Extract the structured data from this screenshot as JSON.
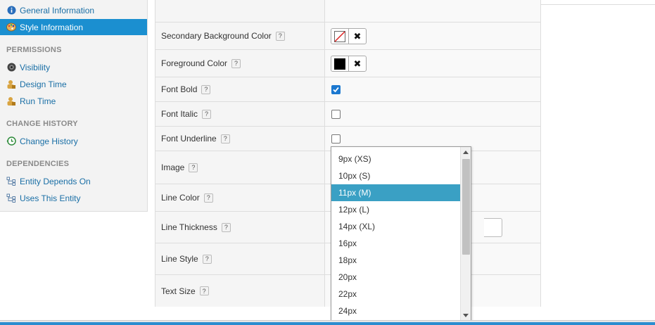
{
  "sidebar": {
    "items_top": [
      {
        "label": "General Information",
        "icon": "info-icon",
        "active": false
      },
      {
        "label": "Style Information",
        "icon": "palette-icon",
        "active": true
      }
    ],
    "sections": [
      {
        "title": "PERMISSIONS",
        "items": [
          {
            "label": "Visibility",
            "icon": "eye-icon"
          },
          {
            "label": "Design Time",
            "icon": "user-lock-icon"
          },
          {
            "label": "Run Time",
            "icon": "user-lock-icon"
          }
        ]
      },
      {
        "title": "CHANGE HISTORY",
        "items": [
          {
            "label": "Change History",
            "icon": "history-icon"
          }
        ]
      },
      {
        "title": "DEPENDENCIES",
        "items": [
          {
            "label": "Entity Depends On",
            "icon": "dependency-icon"
          },
          {
            "label": "Uses This Entity",
            "icon": "dependency-icon"
          }
        ]
      }
    ]
  },
  "properties": {
    "secondary_background_color": {
      "label": "Secondary Background Color",
      "help": "?",
      "clear": "✖"
    },
    "foreground_color": {
      "label": "Foreground Color",
      "help": "?",
      "clear": "✖",
      "value": "#000000"
    },
    "font_bold": {
      "label": "Font Bold",
      "help": "?",
      "checked": true
    },
    "font_italic": {
      "label": "Font Italic",
      "help": "?",
      "checked": false
    },
    "font_underline": {
      "label": "Font Underline",
      "help": "?",
      "checked": false
    },
    "image": {
      "label": "Image",
      "help": "?"
    },
    "line_color": {
      "label": "Line Color",
      "help": "?"
    },
    "line_thickness": {
      "label": "Line Thickness",
      "help": "?"
    },
    "line_style": {
      "label": "Line Style",
      "help": "?"
    },
    "text_size": {
      "label": "Text Size",
      "help": "?"
    }
  },
  "text_size_dropdown": {
    "selected": "11px (M)",
    "options": [
      "9px (XS)",
      "10px (S)",
      "11px (M)",
      "12px (L)",
      "14px (XL)",
      "16px",
      "18px",
      "20px",
      "22px",
      "24px"
    ]
  },
  "colors": {
    "accent": "#1b8fd0",
    "selected_option": "#3aa0c4",
    "link": "#1a6fa6"
  }
}
